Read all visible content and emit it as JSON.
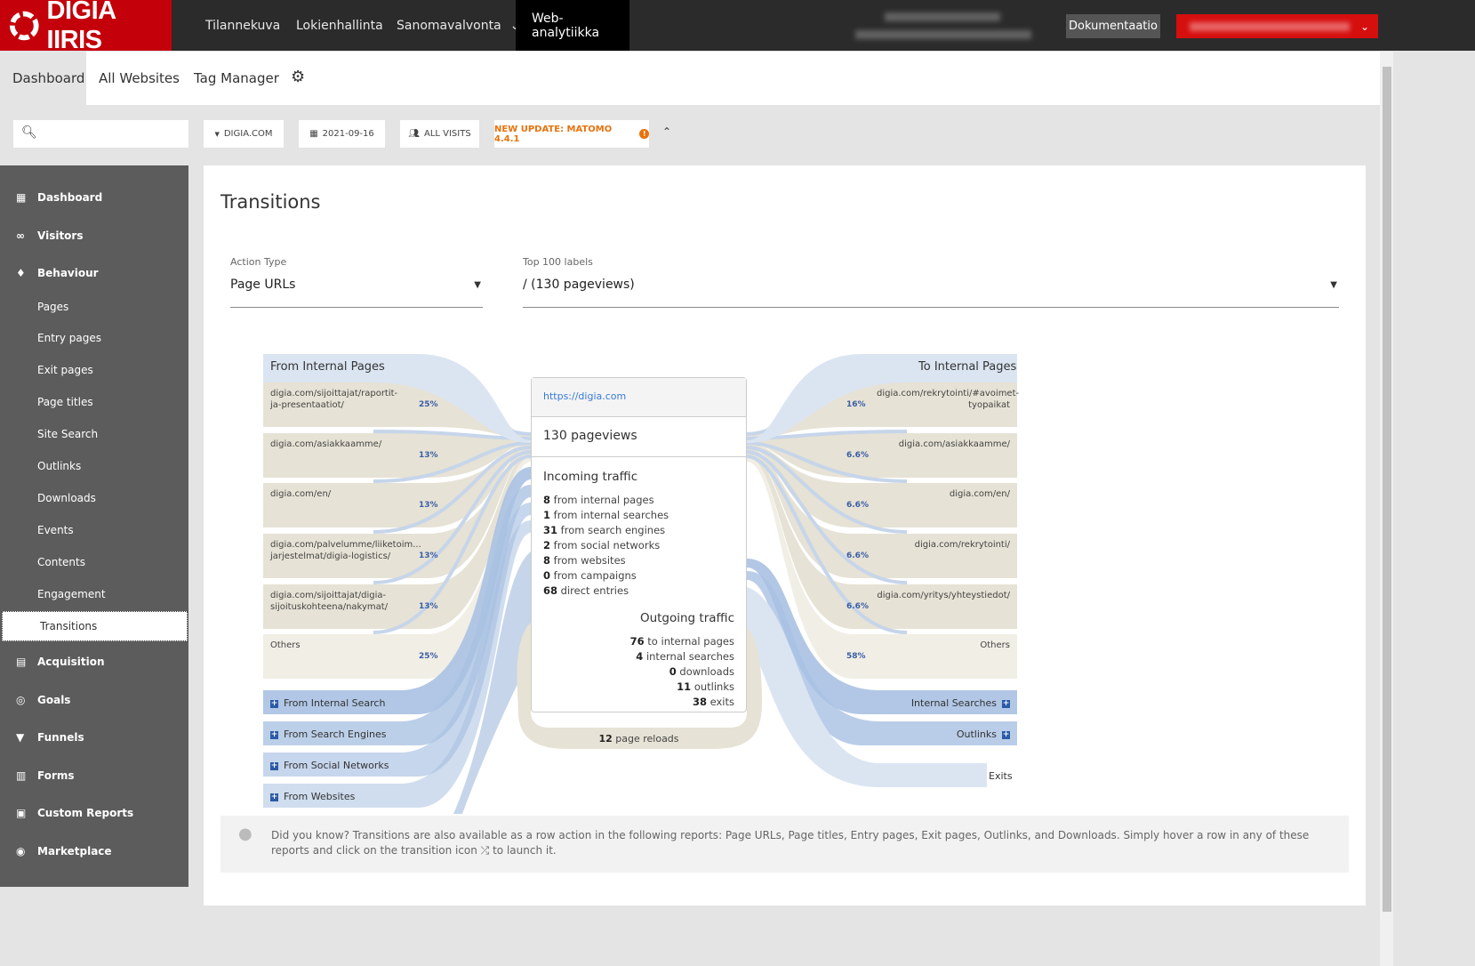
{
  "topbar": {
    "logo": "DIGIA IIRIS",
    "nav": [
      {
        "label": "Tilannekuva"
      },
      {
        "label": "Lokienhallinta"
      },
      {
        "label": "Sanomavalvonta"
      },
      {
        "label": "Web-analytiikka"
      }
    ],
    "doc_button": "Dokumentaatio"
  },
  "subnav": {
    "tabs": [
      {
        "label": "Dashboard"
      },
      {
        "label": "All Websites"
      },
      {
        "label": "Tag Manager"
      }
    ]
  },
  "toolbar": {
    "search_placeholder": "",
    "site": "DIGIA.COM",
    "date": "2021-09-16",
    "segment": "ALL VISITS",
    "update": "NEW UPDATE: MATOMO 4.4.1"
  },
  "sidebar": {
    "items": [
      {
        "label": "Dashboard",
        "icon": "grid-icon",
        "type": "main"
      },
      {
        "label": "Visitors",
        "icon": "binoculars-icon",
        "type": "main"
      },
      {
        "label": "Behaviour",
        "icon": "bell-icon",
        "type": "main"
      },
      {
        "label": "Pages",
        "type": "sub"
      },
      {
        "label": "Entry pages",
        "type": "sub"
      },
      {
        "label": "Exit pages",
        "type": "sub"
      },
      {
        "label": "Page titles",
        "type": "sub"
      },
      {
        "label": "Site Search",
        "type": "sub"
      },
      {
        "label": "Outlinks",
        "type": "sub"
      },
      {
        "label": "Downloads",
        "type": "sub"
      },
      {
        "label": "Events",
        "type": "sub"
      },
      {
        "label": "Contents",
        "type": "sub"
      },
      {
        "label": "Engagement",
        "type": "sub"
      },
      {
        "label": "Transitions",
        "type": "sub",
        "selected": true
      },
      {
        "label": "Acquisition",
        "icon": "acquisition-icon",
        "type": "main"
      },
      {
        "label": "Goals",
        "icon": "target-icon",
        "type": "main"
      },
      {
        "label": "Funnels",
        "icon": "funnel-icon",
        "type": "main"
      },
      {
        "label": "Forms",
        "icon": "clipboard-icon",
        "type": "main"
      },
      {
        "label": "Custom Reports",
        "icon": "reports-icon",
        "type": "main"
      },
      {
        "label": "Marketplace",
        "icon": "marketplace-icon",
        "type": "main"
      }
    ]
  },
  "main": {
    "title": "Transitions",
    "action_type": {
      "label": "Action Type",
      "value": "Page URLs"
    },
    "top_labels": {
      "label": "Top 100 labels",
      "value": "/ (130 pageviews)"
    },
    "left": {
      "header": "From Internal Pages",
      "pages": [
        {
          "label": "digia.com/sijoittajat/raportit-ja-presentaatiot/",
          "pct": "25%"
        },
        {
          "label": "digia.com/asiakkaamme/",
          "pct": "13%"
        },
        {
          "label": "digia.com/en/",
          "pct": "13%"
        },
        {
          "label": "digia.com/palvelumme/liiketoim... jarjestelmat/digia-logistics/",
          "pct": "13%"
        },
        {
          "label": "digia.com/sijoittajat/digia-sijoituskohteena/nakymat/",
          "pct": "13%"
        },
        {
          "label": "Others",
          "pct": "25%"
        }
      ],
      "groups": [
        "From Internal Search",
        "From Search Engines",
        "From Social Networks",
        "From Websites"
      ]
    },
    "right": {
      "header": "To Internal Pages",
      "pages": [
        {
          "label": "digia.com/rekrytointi/#avoimet-tyopaikat",
          "pct": "16%"
        },
        {
          "label": "digia.com/asiakkaamme/",
          "pct": "6.6%"
        },
        {
          "label": "digia.com/en/",
          "pct": "6.6%"
        },
        {
          "label": "digia.com/rekrytointi/",
          "pct": "6.6%"
        },
        {
          "label": "digia.com/yritys/yhteystiedot/",
          "pct": "6.6%"
        },
        {
          "label": "Others",
          "pct": "58%"
        }
      ],
      "groups": [
        "Internal Searches",
        "Outlinks"
      ],
      "exits": "Exits"
    },
    "center": {
      "url": "https://digia.com",
      "pageviews": "130 pageviews",
      "incoming_title": "Incoming traffic",
      "incoming": [
        {
          "n": "8",
          "t": " from internal pages"
        },
        {
          "n": "1",
          "t": " from internal searches"
        },
        {
          "n": "31",
          "t": " from search engines"
        },
        {
          "n": "2",
          "t": " from social networks"
        },
        {
          "n": "8",
          "t": " from websites"
        },
        {
          "n": "0",
          "t": " from campaigns"
        },
        {
          "n": "68",
          "t": " direct entries"
        }
      ],
      "outgoing_title": "Outgoing traffic",
      "outgoing": [
        {
          "n": "76",
          "t": " to internal pages"
        },
        {
          "n": "4",
          "t": " internal searches"
        },
        {
          "n": "0",
          "t": " downloads"
        },
        {
          "n": "11",
          "t": " outlinks"
        },
        {
          "n": "38",
          "t": " exits"
        }
      ],
      "reloads_n": "12",
      "reloads_t": " page reloads"
    },
    "tip": "Did you know? Transitions are also available as a row action in the following reports: Page URLs, Page titles, Entry pages, Exit pages, Outlinks, and Downloads. Simply hover a row in any of these reports and click on the transition icon ⤮ to launch it."
  },
  "colors": {
    "brand": "#c4000b",
    "update": "#e8720c",
    "link": "#3a7bd5",
    "flow_blue": "#a9c1e2",
    "flow_beige": "#e6e2d5"
  }
}
